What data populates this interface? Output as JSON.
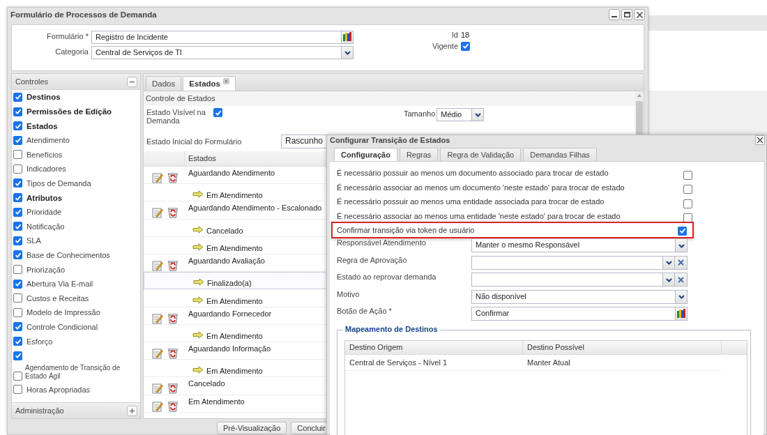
{
  "window": {
    "title": "Formulário de Processos de Demanda"
  },
  "form": {
    "fields": [
      {
        "label": "Formulário *",
        "value": "Registro de Incidente",
        "kind": "lookup"
      },
      {
        "label": "Categoria",
        "value": "Central de Serviços  de TI",
        "kind": "select"
      }
    ],
    "id_label": "Id",
    "id_value": "18",
    "vigente_label": "Vigente",
    "vigente_checked": true
  },
  "sidebar": {
    "title": "Controles",
    "footer": "Administração",
    "items": [
      {
        "label": "Destinos",
        "checked": true,
        "kind": "group"
      },
      {
        "label": "Permissões de Edição",
        "checked": true,
        "kind": "group"
      },
      {
        "label": "Estados",
        "checked": true,
        "kind": "group"
      },
      {
        "label": "Atendimento",
        "checked": true,
        "kind": "item"
      },
      {
        "label": "Benefícios",
        "checked": false,
        "kind": "item"
      },
      {
        "label": "Indicadores",
        "checked": false,
        "kind": "item"
      },
      {
        "label": "Tipos de Demanda",
        "checked": true,
        "kind": "item"
      },
      {
        "label": "Atributos",
        "checked": true,
        "kind": "group"
      },
      {
        "label": "Prioridade",
        "checked": true,
        "kind": "item"
      },
      {
        "label": "Notificação",
        "checked": true,
        "kind": "item"
      },
      {
        "label": "SLA",
        "checked": true,
        "kind": "item"
      },
      {
        "label": "Base de Conhecimentos",
        "checked": true,
        "kind": "item"
      },
      {
        "label": "Priorização",
        "checked": false,
        "kind": "item"
      },
      {
        "label": "Abertura Via E-mail",
        "checked": true,
        "kind": "item"
      },
      {
        "label": "Custos e Receitas",
        "checked": false,
        "kind": "item"
      },
      {
        "label": "Modelo de Impressão",
        "checked": false,
        "kind": "item"
      },
      {
        "label": "Controle Condicional",
        "checked": true,
        "kind": "item"
      },
      {
        "label": "Esforço",
        "checked": true,
        "kind": "item"
      },
      {
        "label": "Agendamento de Transição de Estado Ágil",
        "checked": true,
        "second_checked": false,
        "kind": "wrapped"
      },
      {
        "label": "Horas Apropriadas",
        "checked": false,
        "kind": "item"
      }
    ]
  },
  "tabs": [
    {
      "label": "Dados",
      "selected": false,
      "closable": false
    },
    {
      "label": "Estados",
      "selected": true,
      "closable": true
    }
  ],
  "states_panel": {
    "section_title": "Controle de Estados",
    "visible_label": "Estado Visível na Demanda",
    "visible_checked": true,
    "size_label": "Tamanho",
    "size_value": "Médio",
    "initial_label": "Estado Inicial do Formulário",
    "initial_value": "Rascunho",
    "column": "Estados",
    "rows": [
      {
        "label": "Aguardando Atendimento",
        "kind": "state",
        "selected": false
      },
      {
        "label": "Em Atendimento",
        "kind": "transition",
        "selected": false
      },
      {
        "label": "Aguardando Atendimento - Escalonado",
        "kind": "state",
        "selected": false
      },
      {
        "label": "Cancelado",
        "kind": "transition",
        "selected": false
      },
      {
        "label": "Em Atendimento",
        "kind": "transition",
        "selected": false
      },
      {
        "label": "Aguardando Avaliação",
        "kind": "state",
        "selected": false
      },
      {
        "label": "Finalizado(a)",
        "kind": "transition",
        "selected": true
      },
      {
        "label": "Em Atendimento",
        "kind": "transition",
        "selected": false
      },
      {
        "label": "Aguardando Fornecedor",
        "kind": "state",
        "selected": false
      },
      {
        "label": "Em Atendimento",
        "kind": "transition",
        "selected": false
      },
      {
        "label": "Aguardando Informação",
        "kind": "state",
        "selected": false
      },
      {
        "label": "Em Atendimento",
        "kind": "transition",
        "selected": false
      },
      {
        "label": "Cancelado",
        "kind": "state",
        "selected": false
      },
      {
        "label": "Em Atendimento",
        "kind": "state",
        "selected": false
      }
    ]
  },
  "footer_buttons": [
    "Pré-Visualização",
    "Concluir"
  ],
  "dialog": {
    "title": "Configurar Transição de Estados",
    "tabs": [
      {
        "label": "Configuração",
        "selected": true
      },
      {
        "label": "Regras",
        "selected": false
      },
      {
        "label": "Regra de Validação",
        "selected": false
      },
      {
        "label": "Demandas Filhas",
        "selected": false
      }
    ],
    "options": [
      {
        "label": "É necessário possuir ao menos um documento associado para trocar de estado",
        "checked": false,
        "highlighted": false
      },
      {
        "label": "É necessário associar ao menos um documento 'neste estado' para trocar de estado",
        "checked": false,
        "highlighted": false
      },
      {
        "label": "É necessário possuir ao menos uma entidade associada para trocar de estado",
        "checked": false,
        "highlighted": false
      },
      {
        "label": "É necessário associar ao menos uma entidade 'neste estado' para trocar de estado",
        "checked": false,
        "highlighted": false
      },
      {
        "label": "Confirmar transição via token de usuário",
        "checked": true,
        "highlighted": true
      }
    ],
    "fields": [
      {
        "label": "Responsável Atendimento",
        "value": "Manter o mesmo Responsável",
        "kind": "select"
      },
      {
        "label": "Regra de Aprovação",
        "kind": "select-clear"
      },
      {
        "label": "Estado ao reprovar demanda",
        "kind": "select-clear"
      },
      {
        "label": "Motivo",
        "value": "Não disponível",
        "kind": "select"
      },
      {
        "label": "Botão de Ação *",
        "value": "Confirmar",
        "kind": "lookup"
      }
    ],
    "mapping": {
      "title": "Mapeamento de Destinos",
      "columns": [
        "Destino Origem",
        "Destino Possível"
      ],
      "rows": [
        [
          "Central de Serviços - Nível 1",
          "Manter Atual"
        ]
      ]
    }
  }
}
